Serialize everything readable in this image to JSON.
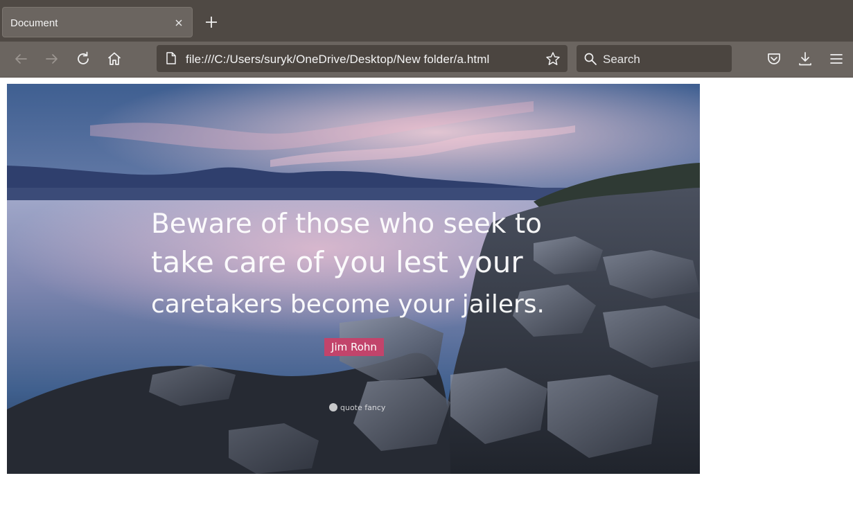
{
  "browser": {
    "tab_title": "Document",
    "url": "file:///C:/Users/suryk/OneDrive/Desktop/New folder/a.html",
    "search_placeholder": "Search"
  },
  "icons": {
    "tab_close": "close-icon",
    "new_tab": "plus-icon",
    "back": "back-arrow-icon",
    "forward": "forward-arrow-icon",
    "reload": "reload-icon",
    "home": "home-icon",
    "page": "page-icon",
    "bookmark": "star-icon",
    "search": "search-icon",
    "pocket": "pocket-icon",
    "downloads": "download-icon",
    "menu": "hamburger-menu-icon"
  },
  "image": {
    "quote_lines": [
      "Beware of those who seek to",
      "take care of you lest your",
      "caretakers become your jailers."
    ],
    "author": "Jim Rohn",
    "watermark": "quote fancy"
  },
  "colors": {
    "tabbar": "#4f4944",
    "toolbar": "#6b6560",
    "field": "#4b4540",
    "author_badge": "#c2446b"
  }
}
